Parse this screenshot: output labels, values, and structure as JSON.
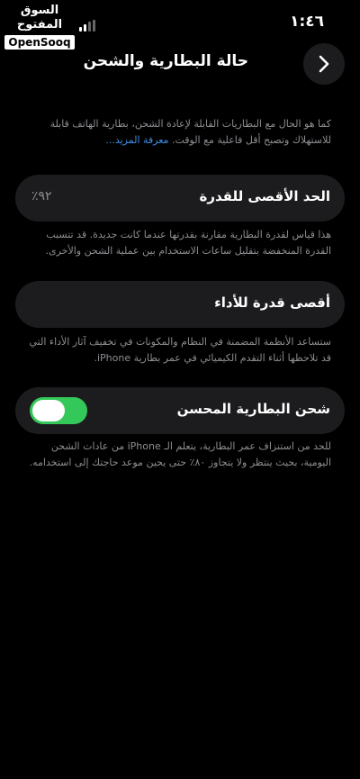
{
  "status_bar": {
    "time": "١:٤٦"
  },
  "watermark": {
    "arabic": "السوق المفتوح",
    "english": "OpenSooq"
  },
  "header": {
    "title": "حالة البطارية والشحن"
  },
  "intro": {
    "text": "كما هو الحال مع البطاريات القابلة لإعادة الشحن، بطارية الهاتف قابلة للاستهلاك وتصبح أقل فاعلية مع الوقت.",
    "link": "معرفة المزيد..."
  },
  "max_capacity": {
    "label": "الحد الأقصى للقدرة",
    "value": "٪٩٢",
    "description": "هذا قياس لقدرة البطارية مقارنة بقدرتها عندما كانت جديدة. قد تتسبب القدرة المنخفضة بتقليل ساعات الاستخدام بين عملية الشحن والأخرى."
  },
  "peak_performance": {
    "label": "أقصى قدرة للأداء",
    "description": "ستساعد الأنظمة المضمنة في النظام والمكونات في تخفيف آثار الأداء التي قد تلاحظها أثناء التقدم الكيميائي في عمر بطارية iPhone."
  },
  "optimized_charging": {
    "label": "شحن البطارية المحسن",
    "enabled": true,
    "description": "للحد من استنزاف عمر البطارية، يتعلم الـ iPhone من عادات الشحن اليومية، بحيث ينتظر ولا يتجاوز ٨٠٪ حتى يحين موعد حاجتك إلى استخدامه."
  },
  "colors": {
    "background": "#000000",
    "card": "#1c1c1e",
    "toggle_on": "#34c759",
    "link": "#3e8ee8",
    "secondary_text": "#8e8e93"
  }
}
